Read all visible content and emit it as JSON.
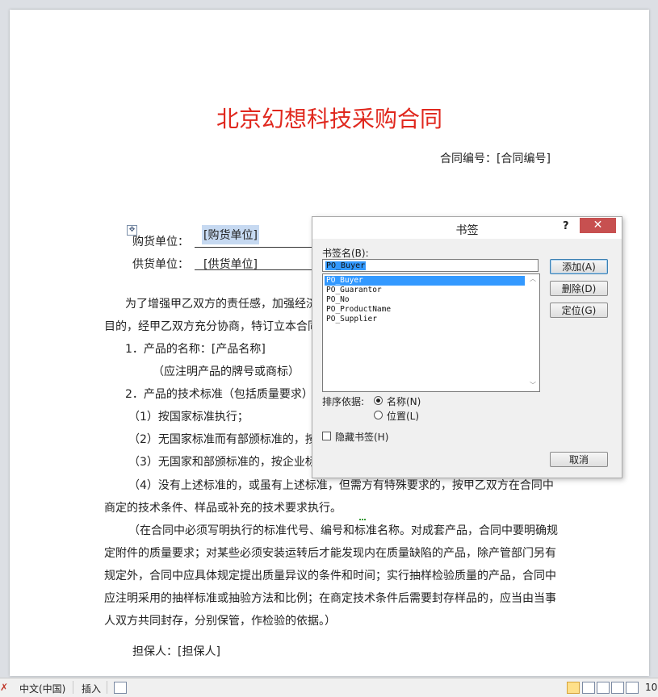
{
  "document": {
    "title": "北京幻想科技采购合同",
    "contract_no": "合同编号：[合同编号]",
    "move_handle_icon": "table-move-handle-icon",
    "buyer_label": "购货单位：",
    "buyer_value": "[购货单位]",
    "supplier_label": "供货单位：",
    "supplier_value": "[供货单位]",
    "lines": [
      "为了增强甲乙双方的责任感，加强经济",
      "目的，经甲乙双方充分协商，特订立本合同",
      "1．产品的名称：[产品名称]",
      "（应注明产品的牌号或商标）",
      "2．产品的技术标准（包括质量要求）",
      "（1）按国家标准执行；",
      "（2）无国家标准而有部颁标准的，按",
      "（3）无国家和部颁标准的，按企业标",
      "（4）没有上述标准的，或虽有上述标准，但需方有特殊要求的，按甲乙双方在合同中",
      "商定的技术条件、样品或补充的技术要求执行。",
      "（在合同中必须写明执行的标准代号、编号和标准名称。对成套产品，合同中要明确规",
      "定附件的质量要求；对某些必须安装运转后才能发现内在质量缺陷的产品，除产管部门另有",
      "规定外，合同中应具体规定提出质量异议的条件和时间；实行抽样检验质量的产品，合同中",
      "应注明采用的抽样标准或抽验方法和比例；在商定技术条件后需要封存样品的，应当由当事",
      "人双方共同封存，分别保管，作检验的依据。）",
      "担保人：[担保人]"
    ]
  },
  "dialog": {
    "title": "书签",
    "help": "?",
    "close": "✕",
    "name_label": "书签名(B):",
    "name_value": "PO_Buyer",
    "items": [
      "PO_Buyer",
      "PO_Guarantor",
      "PO_No",
      "PO_ProductName",
      "PO_Supplier"
    ],
    "selected_index": 0,
    "add_button": "添加(A)",
    "delete_button": "删除(D)",
    "goto_button": "定位(G)",
    "sort_label": "排序依据:",
    "sort_name": "名称(N)",
    "sort_location": "位置(L)",
    "sort_selected": "name",
    "hidden_label": "隐藏书签(H)",
    "hidden_checked": false,
    "cancel_button": "取消"
  },
  "statusbar": {
    "lang_icon": "proofing-error-icon",
    "language": "中文(中国)",
    "mode": "插入",
    "macro_icon": "macro-record-icon",
    "zoom_partial": "10"
  }
}
